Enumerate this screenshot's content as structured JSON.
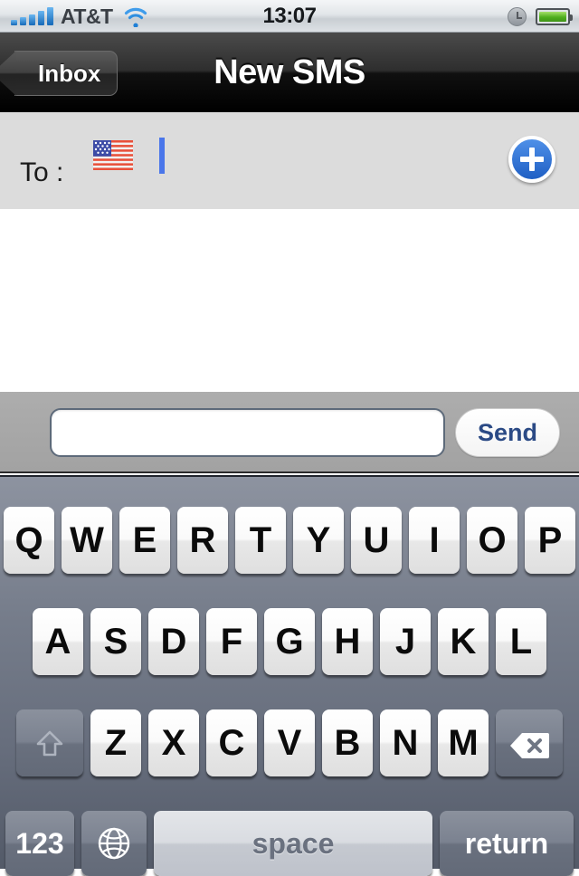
{
  "statusbar": {
    "carrier": "AT&T",
    "time": "13:07",
    "signal_icon": "signal-bars-icon",
    "wifi_icon": "wifi-icon",
    "alarm_icon": "alarm-clock-icon",
    "battery_icon": "battery-icon",
    "battery_level": 100
  },
  "navbar": {
    "back_label": "Inbox",
    "title": "New SMS"
  },
  "recipient_bar": {
    "to_label": "To :",
    "flag_icon": "us-flag-icon",
    "caret": "text-cursor",
    "add_contact_icon": "plus-icon"
  },
  "toolbar": {
    "message_value": "",
    "message_placeholder": "",
    "send_label": "Send"
  },
  "keyboard": {
    "row1": [
      "Q",
      "W",
      "E",
      "R",
      "T",
      "Y",
      "U",
      "I",
      "O",
      "P"
    ],
    "row2": [
      "A",
      "S",
      "D",
      "F",
      "G",
      "H",
      "J",
      "K",
      "L"
    ],
    "row3": [
      "Z",
      "X",
      "C",
      "V",
      "B",
      "N",
      "M"
    ],
    "shift_icon": "shift-arrow-icon",
    "delete_icon": "backspace-icon",
    "numbers_label": "123",
    "globe_icon": "globe-icon",
    "space_label": "space",
    "return_label": "return"
  },
  "colors": {
    "accent_blue": "#2f6fd0",
    "send_text": "#2b4a85",
    "keyboard_bg": "#6f7684",
    "tobar_bg": "#dcdcdc",
    "toolbar_bg": "#a8a8a8"
  }
}
